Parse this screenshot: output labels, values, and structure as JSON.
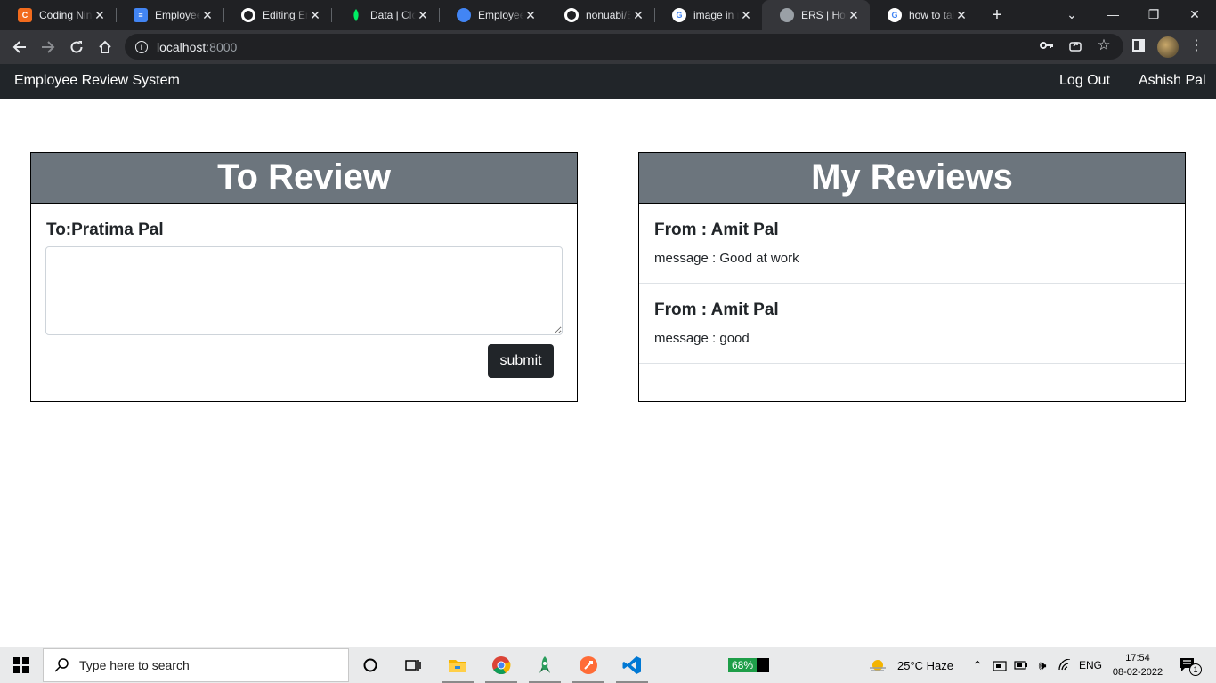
{
  "browser": {
    "tabs": [
      {
        "title": "Coding Ninjas",
        "favicon_color": "#f26b1d",
        "favicon_text": "C",
        "active": false
      },
      {
        "title": "Employee Review",
        "favicon_color": "#4285f4",
        "favicon_text": "≡",
        "active": false
      },
      {
        "title": "Editing Employee",
        "favicon_color": "#ffffff",
        "favicon_text": "",
        "active": false
      },
      {
        "title": "Data | Cloud",
        "favicon_color": "#00ed64",
        "favicon_text": "",
        "active": false
      },
      {
        "title": "Employee-review",
        "favicon_color": "#4285f4",
        "favicon_text": "",
        "active": false
      },
      {
        "title": "nonuabi/Employee",
        "favicon_color": "#ffffff",
        "favicon_text": "",
        "active": false
      },
      {
        "title": "image in markdown",
        "favicon_color": "#ffffff",
        "favicon_text": "G",
        "active": false
      },
      {
        "title": "ERS | Home",
        "favicon_color": "#9aa0a6",
        "favicon_text": "",
        "active": true
      },
      {
        "title": "how to take",
        "favicon_color": "#ffffff",
        "favicon_text": "G",
        "active": false
      }
    ],
    "url_host": "localhost",
    "url_port": ":8000"
  },
  "navbar": {
    "brand": "Employee Review System",
    "logout": "Log Out",
    "user": "Ashish Pal"
  },
  "to_review": {
    "header": "To Review",
    "recipient": "To:Pratima Pal",
    "textarea_value": "",
    "submit": "submit"
  },
  "my_reviews": {
    "header": "My Reviews",
    "items": [
      {
        "from": "From : Amit Pal",
        "message": "message : Good at work"
      },
      {
        "from": "From : Amit Pal",
        "message": "message : good"
      }
    ]
  },
  "taskbar": {
    "search_placeholder": "Type here to search",
    "battery": "68%",
    "weather": "25°C  Haze",
    "language": "ENG",
    "time": "17:54",
    "date": "08-02-2022",
    "notifications": "1"
  }
}
